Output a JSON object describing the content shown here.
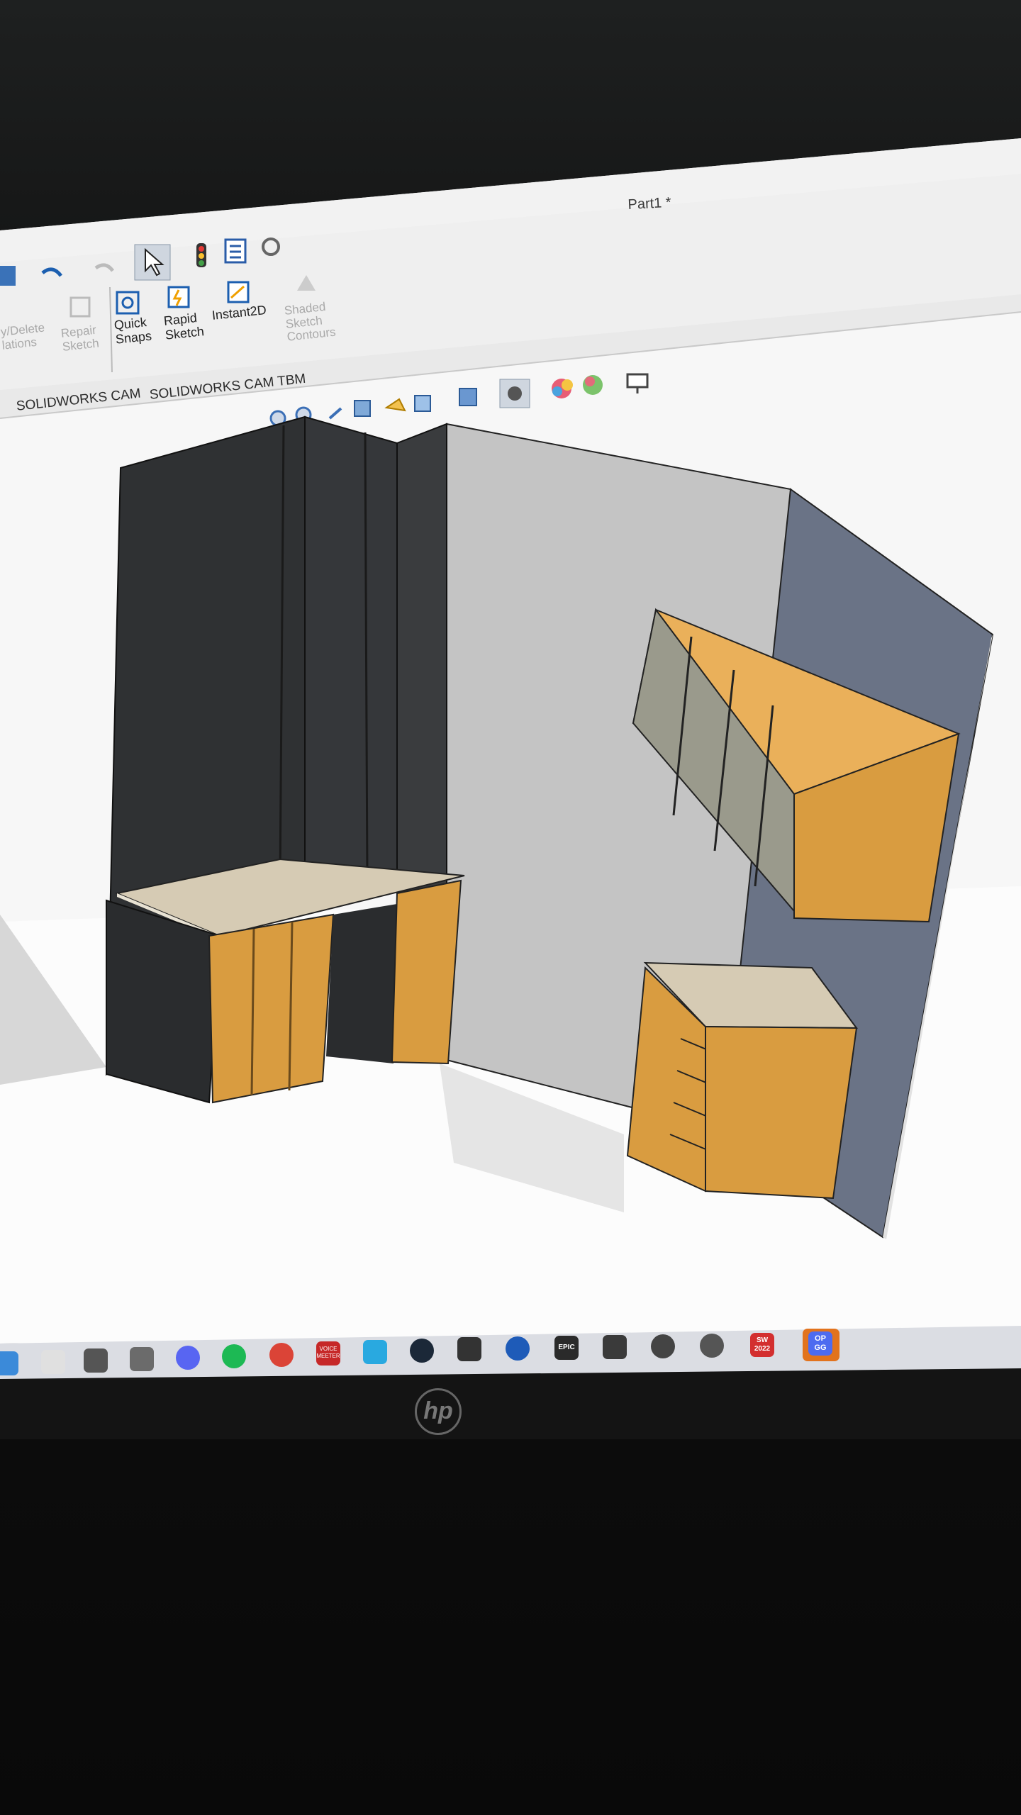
{
  "window": {
    "title": "Part1 *"
  },
  "quick_access": {
    "icons": [
      "save-icon",
      "undo-icon",
      "redo-icon",
      "select-pointer-icon",
      "traffic-light-icon",
      "file-properties-icon",
      "options-gear-icon"
    ]
  },
  "ribbon": {
    "tools": [
      {
        "label": "Display/Delete\nRelations",
        "visible_text": [
          "y/Delete",
          "lations"
        ],
        "enabled": false
      },
      {
        "label": "Repair Sketch",
        "lines": [
          "Repair",
          "Sketch"
        ],
        "enabled": false
      },
      {
        "label": "Quick Snaps",
        "lines": [
          "Quick",
          "Snaps"
        ],
        "enabled": true
      },
      {
        "label": "Rapid Sketch",
        "lines": [
          "Rapid",
          "Sketch"
        ],
        "enabled": true
      },
      {
        "label": "Instant2D",
        "lines": [
          "Instant2D"
        ],
        "enabled": true
      },
      {
        "label": "Shaded Sketch Contours",
        "lines": [
          "Shaded",
          "Sketch",
          "Contours"
        ],
        "enabled": false
      }
    ]
  },
  "tabs": [
    "SOLIDWORKS CAM",
    "SOLIDWORKS CAM TBM"
  ],
  "view_toolbar": {
    "icons": [
      "zoom-to-fit-icon",
      "zoom-area-icon",
      "previous-view-icon",
      "section-view-icon",
      "dynamic-annotation-icon",
      "view-orientation-icon",
      "display-style-icon",
      "hide-show-items-icon",
      "edit-appearance-icon",
      "apply-scene-icon",
      "view-settings-icon",
      "display-monitor-icon"
    ]
  },
  "taskbar": {
    "apps": [
      {
        "name": "start-icon",
        "color": "#3b8ad9"
      },
      {
        "name": "file-explorer-icon",
        "color": "#e0e0e0"
      },
      {
        "name": "calculator-icon",
        "color": "#555555"
      },
      {
        "name": "minecraft-icon",
        "color": "#6b6b6b"
      },
      {
        "name": "discord-icon",
        "color": "#5865f2"
      },
      {
        "name": "spotify-icon",
        "color": "#1db954"
      },
      {
        "name": "chrome-icon",
        "color": "#db4437"
      },
      {
        "name": "voice-meeter-icon",
        "color": "#c62828",
        "text": "VOICE\nMEETER"
      },
      {
        "name": "app-blue-icon",
        "color": "#29a9e0"
      },
      {
        "name": "steam-icon",
        "color": "#1b2838"
      },
      {
        "name": "app-a-icon",
        "color": "#333333"
      },
      {
        "name": "app-round-blue-icon",
        "color": "#1e5bb8"
      },
      {
        "name": "epic-games-icon",
        "color": "#2a2a2a",
        "text": "EPIC"
      },
      {
        "name": "app-dark-icon",
        "color": "#3a3a3a"
      },
      {
        "name": "app-w-icon",
        "color": "#444444"
      },
      {
        "name": "app-webcam-icon",
        "color": "#555555"
      },
      {
        "name": "solidworks-2022-icon",
        "color": "#d32f2f",
        "text": "SW\n2022"
      },
      {
        "name": "op-gg-icon",
        "color": "#4d6bf0",
        "text": "OP\nGG"
      }
    ]
  },
  "monitor": {
    "brand_logo": "hp"
  },
  "colors": {
    "ribbon_bg": "#f1f1f1",
    "viewport_bg": "#f7f7f7",
    "wall_dark": "#2f3133",
    "wall_grey": "#bdbdbd",
    "wall_blue": "#6a7386",
    "wood": "#d99c40",
    "countertop": "#d6cbb4",
    "cabinet_door": "#9a9a8c"
  }
}
